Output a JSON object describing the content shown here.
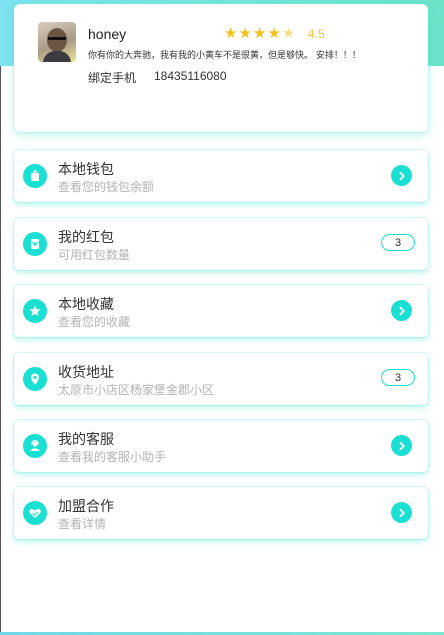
{
  "profile": {
    "username": "honey",
    "rating": "4.5",
    "rating_value": 4.5,
    "rating_max": 5,
    "motto": "你有你的大奔驰，我有我的小黄车不是很黄，但是够快。 安排！！！",
    "phone_label": "绑定手机",
    "phone_value": "18435116080"
  },
  "menu": {
    "items": [
      {
        "title": "本地钱包",
        "subtitle": "查看您的钱包余额",
        "icon": "wallet-icon"
      },
      {
        "title": "我的红包",
        "subtitle": "可用红包数量",
        "icon": "red-packet-icon",
        "badge": "3"
      },
      {
        "title": "本地收藏",
        "subtitle": "查看您的收藏",
        "icon": "star-icon"
      },
      {
        "title": "收货地址",
        "subtitle": "太原市小店区杨家堡金郡小区",
        "icon": "location-pin-icon",
        "badge": "3"
      },
      {
        "title": "我的客服",
        "subtitle": "查看我的客服小助手",
        "icon": "customer-service-icon"
      },
      {
        "title": "加盟合作",
        "subtitle": "查看详情",
        "icon": "handshake-icon"
      }
    ]
  },
  "colors": {
    "accent": "#19e0d2",
    "header_gradient_start": "#7ee3ee",
    "header_gradient_end": "#6ce3c8",
    "star": "#f4c21a"
  }
}
